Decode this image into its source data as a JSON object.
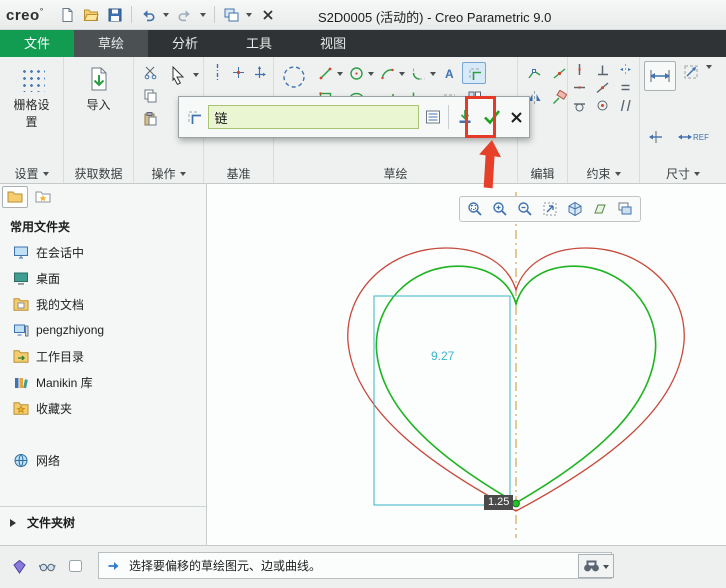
{
  "titlebar": {
    "logo": "creo",
    "logo_mark": "°",
    "title": "S2D0005 (活动的) - Creo Parametric 9.0"
  },
  "tabs": {
    "file": "文件",
    "sketch": "草绘",
    "analysis": "分析",
    "tools": "工具",
    "view": "视图"
  },
  "ribbon": {
    "settings": {
      "button": "栅格设置",
      "label": "设置"
    },
    "get_data": {
      "button": "导入",
      "label": "获取数据"
    },
    "operations": {
      "label": "操作"
    },
    "datum": {
      "label": "基准"
    },
    "sketch": {
      "label": "草绘"
    },
    "edit": {
      "label": "编辑"
    },
    "constrain": {
      "label": "约束"
    },
    "dimension": {
      "label": "尺寸",
      "ref_label": "REF"
    }
  },
  "offset_panel": {
    "input_value": "链"
  },
  "sidebar": {
    "header": "常用文件夹",
    "items": [
      "在会话中",
      "桌面",
      "我的文档",
      "pengzhiyong",
      "工作目录",
      "Manikin 库",
      "收藏夹",
      "网络"
    ],
    "folder_tree": "文件夹树"
  },
  "canvas": {
    "height_dimension": "9.27",
    "offset_dimension": "1.25",
    "colors": {
      "outer_heart": "#c8493b",
      "inner_heart": "#1fb421",
      "centerline": "#c9952f",
      "selection": "#3ab5c8"
    }
  },
  "statusbar": {
    "message": "选择要偏移的草绘图元、边或曲线。"
  }
}
